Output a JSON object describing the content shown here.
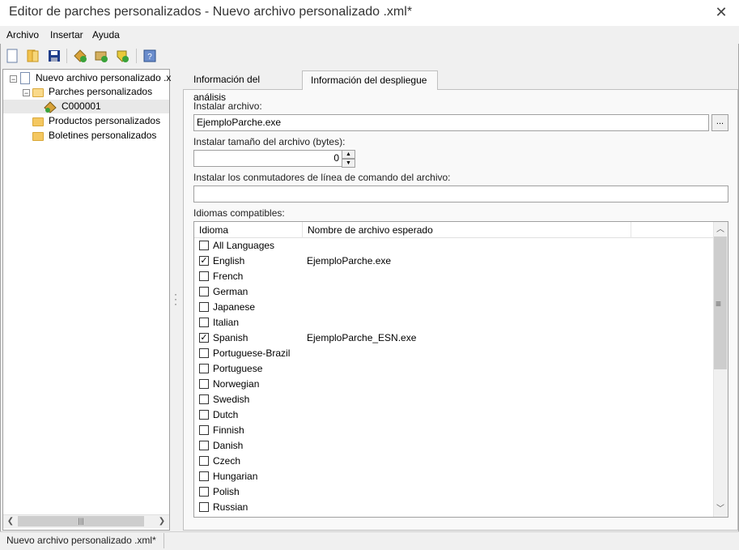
{
  "window": {
    "title": "Editor de parches personalizados - Nuevo archivo personalizado .xml*",
    "close_glyph": "✕"
  },
  "menu": [
    "Archivo",
    "Insertar",
    "Ayuda"
  ],
  "toolbar": [
    "new-icon",
    "open-icon",
    "save-icon",
    "add-patch-icon",
    "add-product-icon",
    "add-bulletin-icon",
    "help-icon"
  ],
  "tree": {
    "root": "Nuevo archivo personalizado .x",
    "patches": "Parches personalizados",
    "patch_item": "C000001",
    "products": "Productos personalizados",
    "bulletins": "Boletines personalizados",
    "expander_minus": "−"
  },
  "tabs": {
    "analysis": "Información del análisis",
    "deploy": "Información del despliegue"
  },
  "deploy": {
    "install_file_label": "Instalar archivo:",
    "install_file_value": "EjemploParche.exe",
    "browse_label": "...",
    "size_label": "Instalar tamaño del archivo (bytes):",
    "size_value": "0",
    "switches_label": "Instalar los conmutadores de línea de comando del archivo:",
    "switches_value": "",
    "languages_label": "Idiomas compatibles:",
    "col_language": "Idioma",
    "col_filename": "Nombre de archivo esperado",
    "languages": [
      {
        "name": "All Languages",
        "checked": false,
        "file": ""
      },
      {
        "name": "English",
        "checked": true,
        "file": "EjemploParche.exe"
      },
      {
        "name": "French",
        "checked": false,
        "file": ""
      },
      {
        "name": "German",
        "checked": false,
        "file": ""
      },
      {
        "name": "Japanese",
        "checked": false,
        "file": ""
      },
      {
        "name": "Italian",
        "checked": false,
        "file": ""
      },
      {
        "name": "Spanish",
        "checked": true,
        "file": "EjemploParche_ESN.exe"
      },
      {
        "name": "Portuguese-Brazil",
        "checked": false,
        "file": ""
      },
      {
        "name": "Portuguese",
        "checked": false,
        "file": ""
      },
      {
        "name": "Norwegian",
        "checked": false,
        "file": ""
      },
      {
        "name": "Swedish",
        "checked": false,
        "file": ""
      },
      {
        "name": "Dutch",
        "checked": false,
        "file": ""
      },
      {
        "name": "Finnish",
        "checked": false,
        "file": ""
      },
      {
        "name": "Danish",
        "checked": false,
        "file": ""
      },
      {
        "name": "Czech",
        "checked": false,
        "file": ""
      },
      {
        "name": "Hungarian",
        "checked": false,
        "file": ""
      },
      {
        "name": "Polish",
        "checked": false,
        "file": ""
      },
      {
        "name": "Russian",
        "checked": false,
        "file": ""
      }
    ]
  },
  "status": {
    "text": "Nuevo archivo personalizado .xml*"
  }
}
